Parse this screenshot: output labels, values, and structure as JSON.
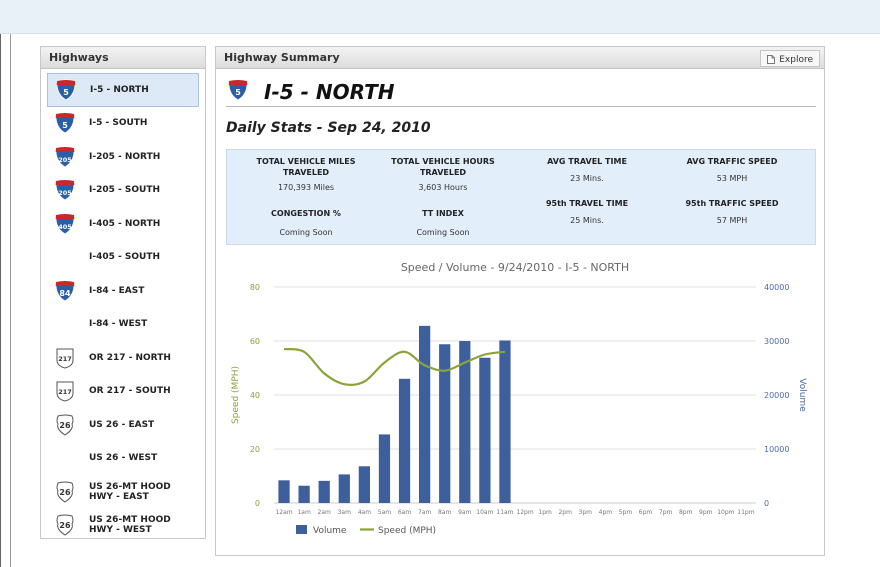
{
  "highways_panel": {
    "title": "Highways",
    "items": [
      {
        "label": "I-5 - NORTH",
        "label2": "",
        "icon": "interstate-shield-icon",
        "shield": "5",
        "selected": true
      },
      {
        "label": "I-5 - SOUTH",
        "label2": "",
        "icon": "interstate-shield-icon",
        "shield": "5",
        "selected": false
      },
      {
        "label": "I-205 - NORTH",
        "label2": "",
        "icon": "interstate-shield-icon",
        "shield": "205",
        "selected": false
      },
      {
        "label": "I-205 - SOUTH",
        "label2": "",
        "icon": "interstate-shield-icon",
        "shield": "205",
        "selected": false
      },
      {
        "label": "I-405 - NORTH",
        "label2": "",
        "icon": "interstate-shield-icon",
        "shield": "405",
        "selected": false
      },
      {
        "label": "I-405 - SOUTH",
        "label2": "",
        "icon": "none",
        "shield": "",
        "selected": false
      },
      {
        "label": "I-84 - EAST",
        "label2": "",
        "icon": "interstate-shield-icon",
        "shield": "84",
        "selected": false
      },
      {
        "label": "I-84 - WEST",
        "label2": "",
        "icon": "none",
        "shield": "",
        "selected": false
      },
      {
        "label": "OR 217 - NORTH",
        "label2": "",
        "icon": "state-route-shield-icon",
        "shield": "217",
        "selected": false
      },
      {
        "label": "OR 217 - SOUTH",
        "label2": "",
        "icon": "state-route-shield-icon",
        "shield": "217",
        "selected": false
      },
      {
        "label": "US 26 - EAST",
        "label2": "",
        "icon": "us-route-shield-icon",
        "shield": "26",
        "selected": false
      },
      {
        "label": "US 26 - WEST",
        "label2": "",
        "icon": "none",
        "shield": "",
        "selected": false
      },
      {
        "label": "US 26-MT HOOD",
        "label2": "HWY - EAST",
        "icon": "us-route-shield-icon",
        "shield": "26",
        "selected": false
      },
      {
        "label": "US 26-MT HOOD",
        "label2": "HWY - WEST",
        "icon": "us-route-shield-icon",
        "shield": "26",
        "selected": false
      }
    ]
  },
  "summary_panel": {
    "title": "Highway Summary",
    "explore_label": "Explore",
    "explore_icon": "document-icon",
    "highway_title": "I-5 - NORTH",
    "highway_shield": "5",
    "daily_stats_title": "Daily Stats - Sep 24, 2010",
    "stats": {
      "vmt_label_1": "TOTAL VEHICLE MILES",
      "vmt_label_2": "TRAVELED",
      "vmt_value": "170,393 Miles",
      "vht_label_1": "TOTAL VEHICLE HOURS",
      "vht_label_2": "TRAVELED",
      "vht_value": "3,603 Hours",
      "att_label": "AVG TRAVEL TIME",
      "att_value": "23 Mins.",
      "ats_label": "AVG TRAFFIC SPEED",
      "ats_value": "53 MPH",
      "cong_label": "CONGESTION %",
      "cong_value": "Coming Soon",
      "tti_label": "TT INDEX",
      "tti_value": "Coming Soon",
      "p95tt_label": "95th TRAVEL TIME",
      "p95tt_value": "25 Mins.",
      "p95ts_label": "95th TRAFFIC SPEED",
      "p95ts_value": "57 MPH"
    }
  },
  "colors": {
    "volume_bar": "#3d5f9c",
    "speed_line": "#8aa33a",
    "left_axis_text": "#8aa33a",
    "right_axis_text": "#4a6aa8"
  },
  "chart_data": {
    "type": "bar",
    "title": "Speed / Volume - 9/24/2010 - I-5 - NORTH",
    "categories": [
      "12am",
      "1am",
      "2am",
      "3am",
      "4am",
      "5am",
      "6am",
      "7am",
      "8am",
      "9am",
      "10am",
      "11am",
      "12pm",
      "1pm",
      "2pm",
      "3pm",
      "4pm",
      "5pm",
      "6pm",
      "7pm",
      "8pm",
      "9pm",
      "10pm",
      "11pm"
    ],
    "left_axis": {
      "label": "Speed (MPH)",
      "ylim": [
        0,
        80
      ],
      "ticks": [
        "0",
        "20",
        "40",
        "60",
        "80"
      ]
    },
    "right_axis": {
      "label": "Volume",
      "ylim": [
        0,
        40000
      ],
      "ticks": [
        "0",
        "10000",
        "20000",
        "30000",
        "40000"
      ]
    },
    "series": [
      {
        "name": "Volume",
        "type": "bar",
        "axis": "right",
        "values": [
          4200,
          3200,
          4100,
          5300,
          6800,
          12700,
          23000,
          32800,
          29400,
          30000,
          26900,
          30100,
          null,
          null,
          null,
          null,
          null,
          null,
          null,
          null,
          null,
          null,
          null,
          null
        ]
      },
      {
        "name": "Speed (MPH)",
        "type": "line",
        "axis": "left",
        "values": [
          57,
          56,
          48,
          44,
          45,
          52,
          56,
          51,
          49,
          52,
          55,
          56,
          null,
          null,
          null,
          null,
          null,
          null,
          null,
          null,
          null,
          null,
          null,
          null
        ]
      }
    ],
    "legend_position": "bottom-left",
    "grid": "horizontal"
  }
}
